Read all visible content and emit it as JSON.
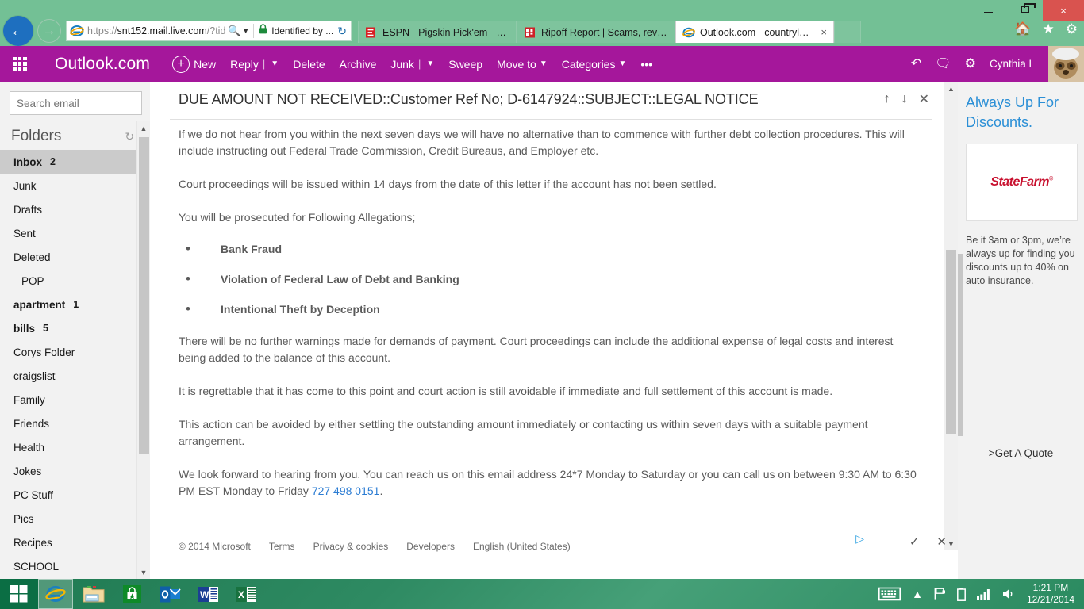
{
  "browser": {
    "url_secure": "https://",
    "url_main": "snt152.mail.live.com",
    "url_query": "/?tid=(",
    "identified_by": "Identified by ...",
    "back_icon": "back-arrow-icon",
    "forward_icon": "forward-arrow-icon",
    "search_icon": "search-icon",
    "lock_icon": "lock-icon",
    "refresh_icon": "refresh-icon",
    "tabs": [
      {
        "label": "ESPN - Pigskin Pick'em - Seattl...",
        "active": false
      },
      {
        "label": "Ripoff Report | Scams, reviews,...",
        "active": false
      },
      {
        "label": "Outlook.com - countryluvi...",
        "active": true
      }
    ],
    "tab_close_label": "×",
    "chrome_tools": [
      "home-icon",
      "favorites-icon",
      "settings-icon"
    ],
    "window_minimize": "minimize-button",
    "window_restore": "restore-button",
    "window_close": "×"
  },
  "outlook": {
    "brand": "Outlook.com",
    "waffle_label": "app-launcher",
    "commands": [
      {
        "label": "New",
        "icon": "plus-circle-icon",
        "caret": false
      },
      {
        "label": "Reply",
        "split": "|",
        "caret": true
      },
      {
        "label": "Delete",
        "caret": false
      },
      {
        "label": "Archive",
        "caret": false
      },
      {
        "label": "Junk",
        "split": "|",
        "caret": true
      },
      {
        "label": "Sweep",
        "caret": false
      },
      {
        "label": "Move to",
        "caret": true
      },
      {
        "label": "Categories",
        "caret": true
      },
      {
        "label": "•••",
        "caret": false
      }
    ],
    "right_icons": [
      "undo-icon",
      "feedback-icon",
      "gear-icon"
    ],
    "user_name": "Cynthia L",
    "accent_color": "#a5179b"
  },
  "sidebar": {
    "search_placeholder": "Search email",
    "search_value": "",
    "folders_heading": "Folders",
    "refresh_icon": "refresh-icon",
    "items": [
      {
        "label": "Inbox",
        "count": "2",
        "selected": true,
        "bold": true,
        "indent": false
      },
      {
        "label": "Junk",
        "count": "",
        "selected": false,
        "bold": false,
        "indent": false
      },
      {
        "label": "Drafts",
        "count": "",
        "selected": false,
        "bold": false,
        "indent": false
      },
      {
        "label": "Sent",
        "count": "",
        "selected": false,
        "bold": false,
        "indent": false
      },
      {
        "label": "Deleted",
        "count": "",
        "selected": false,
        "bold": false,
        "indent": false
      },
      {
        "label": "POP",
        "count": "",
        "selected": false,
        "bold": false,
        "indent": true
      },
      {
        "label": "apartment",
        "count": "1",
        "selected": false,
        "bold": true,
        "indent": false
      },
      {
        "label": "bills",
        "count": "5",
        "selected": false,
        "bold": true,
        "indent": false
      },
      {
        "label": "Corys Folder",
        "count": "",
        "selected": false,
        "bold": false,
        "indent": false
      },
      {
        "label": "craigslist",
        "count": "",
        "selected": false,
        "bold": false,
        "indent": false
      },
      {
        "label": "Family",
        "count": "",
        "selected": false,
        "bold": false,
        "indent": false
      },
      {
        "label": "Friends",
        "count": "",
        "selected": false,
        "bold": false,
        "indent": false
      },
      {
        "label": "Health",
        "count": "",
        "selected": false,
        "bold": false,
        "indent": false
      },
      {
        "label": "Jokes",
        "count": "",
        "selected": false,
        "bold": false,
        "indent": false
      },
      {
        "label": "PC Stuff",
        "count": "",
        "selected": false,
        "bold": false,
        "indent": false
      },
      {
        "label": "Pics",
        "count": "",
        "selected": false,
        "bold": false,
        "indent": false
      },
      {
        "label": "Recipes",
        "count": "",
        "selected": false,
        "bold": false,
        "indent": false
      },
      {
        "label": "SCHOOL",
        "count": "",
        "selected": false,
        "bold": false,
        "indent": false
      }
    ]
  },
  "message": {
    "subject": "DUE AMOUNT NOT RECEIVED::Customer Ref No; D-6147924::SUBJECT::LEGAL NOTICE",
    "actions": [
      "up-arrow-icon",
      "down-arrow-icon",
      "close-icon"
    ],
    "paragraphs": [
      "If we do not hear from you within the next seven days we will have no alternative than to commence with further debt collection procedures. This will include instructing out Federal Trade Commission, Credit Bureaus, and Employer etc.",
      "Court proceedings will be issued within 14 days from the date of this letter if the account has not been settled.",
      "You will be prosecuted for Following Allegations;"
    ],
    "allegations": [
      "Bank Fraud",
      "Violation of Federal Law of Debt and Banking",
      "Intentional Theft by Deception"
    ],
    "paragraphs_after": [
      "There will be no further warnings made for demands of payment. Court proceedings can include the additional expense of legal costs and interest being added to the balance of this account.",
      "It is regrettable that it has come to this point and court action is still avoidable if immediate and full settlement of this account is made.",
      "This action can be avoided by either settling the outstanding amount immediately or contacting us within seven days with a suitable payment arrangement."
    ],
    "closing_before_link": "We look forward to hearing from you. You can reach us on this email address 24*7 Monday to Saturday or you can call us on between 9:30 AM to 6:30 PM EST Monday to Friday ",
    "phone_link": "727 498 0151",
    "closing_after_link": "."
  },
  "footer": {
    "copyright": "© 2014 Microsoft",
    "links": [
      "Terms",
      "Privacy & cookies",
      "Developers",
      "English (United States)"
    ],
    "adchoices_icon": "adchoices-icon",
    "tools": [
      "check-icon",
      "close-icon"
    ]
  },
  "ad": {
    "headline": "Always Up For Discounts.",
    "brand_state": "State",
    "brand_farm": "Farm",
    "brand_mark": "®",
    "copy": "Be it 3am or 3pm, we’re always up for finding you discounts up to 40% on auto insurance.",
    "cta": ">Get A Quote",
    "headline_color": "#2b8fd6",
    "brand_color": "#c8102e"
  },
  "taskbar": {
    "start_icon": "windows-start-icon",
    "items": [
      {
        "name": "internet-explorer-icon",
        "active": true
      },
      {
        "name": "file-explorer-icon",
        "active": false
      },
      {
        "name": "windows-store-icon",
        "active": false
      },
      {
        "name": "outlook-icon",
        "active": false
      },
      {
        "name": "word-icon",
        "active": false
      },
      {
        "name": "excel-icon",
        "active": false
      }
    ],
    "tray_icons": [
      "keyboard-icon",
      "show-hidden-icons-icon",
      "flag-icon",
      "battery-icon",
      "network-icon",
      "volume-icon"
    ],
    "time": "1:21 PM",
    "date": "12/21/2014"
  }
}
